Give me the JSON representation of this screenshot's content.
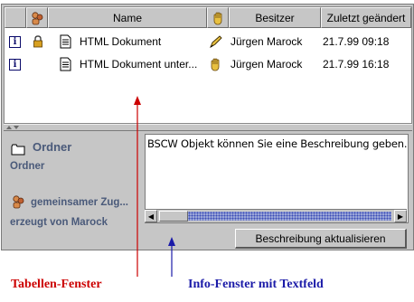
{
  "table": {
    "columns": [
      "Name",
      "Besitzer",
      "Zuletzt geändert"
    ],
    "rows": [
      {
        "name": "HTML Dokument",
        "owner": "Jürgen Marock",
        "modified": "21.7.99 09:18"
      },
      {
        "name": "HTML Dokument unter...",
        "owner": "Jürgen Marock",
        "modified": "21.7.99 16:18"
      }
    ]
  },
  "info": {
    "folder_title": "Ordner",
    "folder_type": "Ordner",
    "shared_label": "gemeinsamer Zug...",
    "created_by": "erzeugt von Marock",
    "description_text": "BSCW Objekt können Sie eine Beschreibung geben.",
    "update_button": "Beschreibung aktualisieren"
  },
  "annotations": {
    "table_window": "Tabellen-Fenster",
    "info_window": "Info-Fenster mit Textfeld"
  },
  "colors": {
    "table_annotation": "#cc0000",
    "info_annotation": "#1a1aa8",
    "panel_label": "#4a5a7a"
  }
}
